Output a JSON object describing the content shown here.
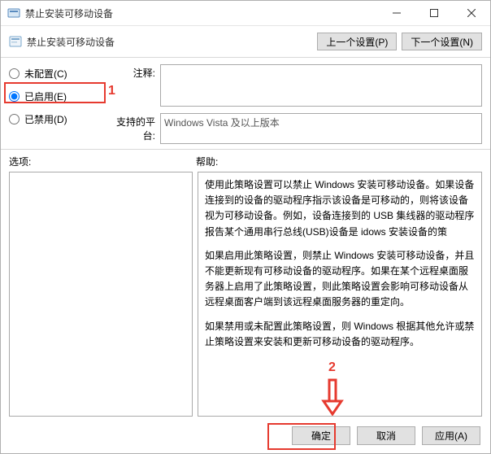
{
  "titlebar": {
    "title": "禁止安装可移动设备"
  },
  "header": {
    "policy_title": "禁止安装可移动设备",
    "prev_btn": "上一个设置(P)",
    "next_btn": "下一个设置(N)"
  },
  "radios": {
    "not_configured": "未配置(C)",
    "enabled": "已启用(E)",
    "disabled": "已禁用(D)"
  },
  "fields": {
    "comment_label": "注释:",
    "comment_value": "",
    "supported_label": "支持的平台:",
    "supported_value": "Windows Vista 及以上版本"
  },
  "lower": {
    "options_label": "选项:",
    "help_label": "帮助:"
  },
  "help": {
    "p1": "使用此策略设置可以禁止 Windows 安装可移动设备。如果设备连接到的设备的驱动程序指示该设备是可移动的，则将该设备视为可移动设备。例如，设备连接到的 USB 集线器的驱动程序报告某个通用串行总线(USB)设备是                                                                      idows 安装设备的策",
    "p2": "如果启用此策略设置，则禁止 Windows 安装可移动设备，并且不能更新现有可移动设备的驱动程序。如果在某个远程桌面服务器上启用了此策略设置，则此策略设置会影响可移动设备从远程桌面客户端到该远程桌面服务器的重定向。",
    "p3": "如果禁用或未配置此策略设置，则 Windows 根据其他允许或禁止策略设置来安装和更新可移动设备的驱动程序。"
  },
  "footer": {
    "ok": "确定",
    "cancel": "取消",
    "apply": "应用(A)"
  },
  "annotations": {
    "num1": "1",
    "num2": "2"
  },
  "colors": {
    "annotation": "#e63a2f"
  }
}
